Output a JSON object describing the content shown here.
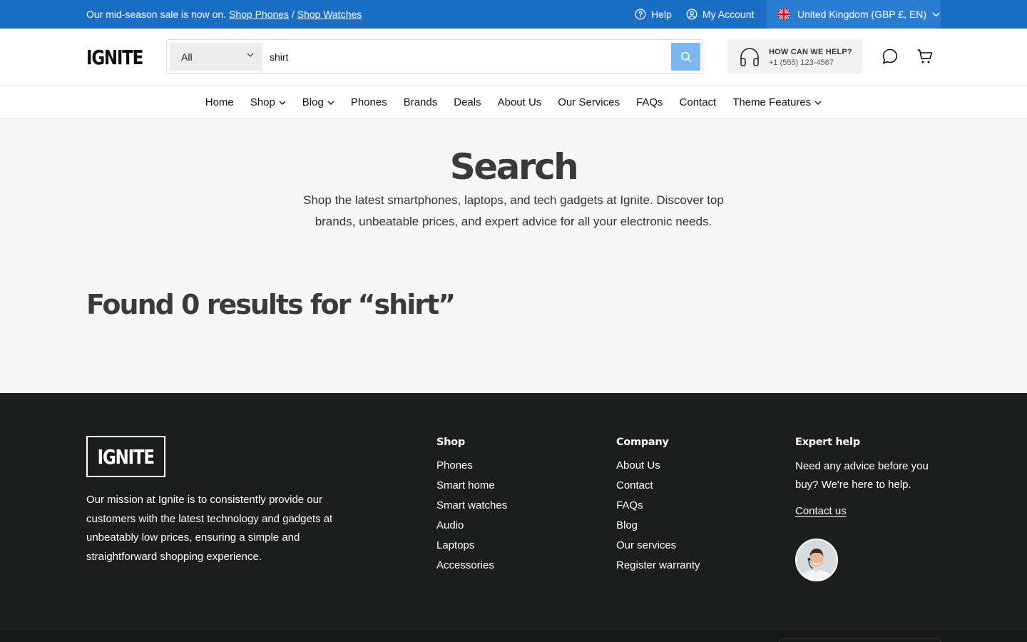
{
  "announcement": {
    "text": "Our mid-season sale is now on.",
    "link1": "Shop Phones",
    "separator": "/",
    "link2": "Shop Watches"
  },
  "utility": {
    "help": "Help",
    "account": "My Account",
    "locale": "United Kingdom (GBP £, EN)"
  },
  "header": {
    "logo": "IGNITE",
    "search": {
      "category": "All",
      "query": "shirt"
    },
    "help_title": "HOW CAN WE HELP?",
    "help_phone": "+1 (555) 123-4567"
  },
  "nav": {
    "items": [
      {
        "label": "Home"
      },
      {
        "label": "Shop"
      },
      {
        "label": "Blog"
      },
      {
        "label": "Phones"
      },
      {
        "label": "Brands"
      },
      {
        "label": "Deals"
      },
      {
        "label": "About Us"
      },
      {
        "label": "Our Services"
      },
      {
        "label": "FAQs"
      },
      {
        "label": "Contact"
      },
      {
        "label": "Theme Features"
      }
    ]
  },
  "main": {
    "title": "Search",
    "description": "Shop the latest smartphones, laptops, and tech gadgets at Ignite. Discover top brands, unbeatable prices, and expert advice for all your electronic needs.",
    "results": "Found 0 results for “shirt”"
  },
  "footer": {
    "logo": "IGNITE",
    "mission": "Our mission at Ignite is to consistently provide our customers with the latest technology and gadgets at unbeatably low prices, ensuring a simple and straightforward shopping experience.",
    "shop": {
      "heading": "Shop",
      "links": [
        "Phones",
        "Smart home",
        "Smart watches",
        "Audio",
        "Laptops",
        "Accessories"
      ]
    },
    "company": {
      "heading": "Company",
      "links": [
        "About Us",
        "Contact",
        "FAQs",
        "Blog",
        "Our services",
        "Register warranty"
      ]
    },
    "expert": {
      "heading": "Expert help",
      "text": "Need any advice before you buy? We're here to help.",
      "link": "Contact us"
    }
  },
  "colors": {
    "announcement_bg": "#1a6fc4",
    "search_button": "#7db7ee",
    "footer_bg": "#1c1d1d"
  }
}
